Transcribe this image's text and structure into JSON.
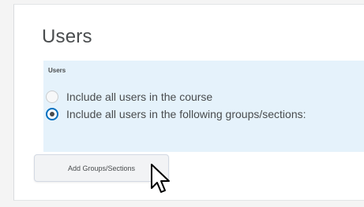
{
  "section": {
    "title": "Users"
  },
  "users_group": {
    "label": "Users",
    "options": [
      {
        "label": "Include all users in the course",
        "selected": false
      },
      {
        "label": "Include all users in the following groups/sections:",
        "selected": true
      }
    ]
  },
  "actions": {
    "add_groups_label": "Add Groups/Sections"
  },
  "icons": {
    "cursor": "mouse-pointer-icon"
  },
  "colors": {
    "panel_background": "#e5f2fb",
    "selected_radio_ring": "#006fbf",
    "text": "#494c4e"
  }
}
